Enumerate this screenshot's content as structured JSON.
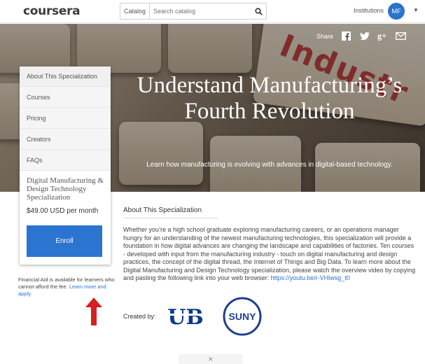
{
  "header": {
    "logo_text": "coursera",
    "catalog_label": "Catalog",
    "search_placeholder": "Search catalog",
    "institutions_label": "Institutions",
    "avatar_initials": "MF"
  },
  "hero": {
    "share_label": "Share",
    "background_word": "Industr",
    "title": "Understand Manufacturing’s Fourth Revolution",
    "subtitle": "Learn how manufacturing is evolving with advances in digital-based technology."
  },
  "sidebar": {
    "nav": [
      {
        "label": "About This Specialization"
      },
      {
        "label": "Courses"
      },
      {
        "label": "Pricing"
      },
      {
        "label": "Creators"
      },
      {
        "label": "FAQs"
      }
    ],
    "spec_name": "Digital Manufacturing & Design Technology Specialization",
    "price": "$49.00 USD per month",
    "enroll_label": "Enroll"
  },
  "financial_aid": {
    "text": "Financial Aid is available for learners who cannot afford the fee.",
    "link_text": "Learn more and apply."
  },
  "about": {
    "heading": "About This Specialization",
    "body": "Whether you’re a high school graduate exploring manufacturing careers, or an operations manager hungry for an understanding of the newest manufacturing technologies, this specialization will provide a foundation in how digital advances are changing the landscape and capabilities of factories. Ten courses - developed with input from the manufacturing industry - touch on digital manufacturing and design practices, the concept of the digital thread, the Internet of Things and Big Data. To learn more about the Digital Manufacturing and Design Technology specialization, please watch the overview video by copying and pasting the following link into your web browser:",
    "link": "https://youtu.be/r-VHiwsg_t0"
  },
  "creators": {
    "label": "Created by:",
    "ub_logo_text": "UB",
    "suny_logo_text": "SUNY"
  },
  "colors": {
    "brand_blue": "#2b74d0",
    "arrow_red": "#d62020"
  }
}
